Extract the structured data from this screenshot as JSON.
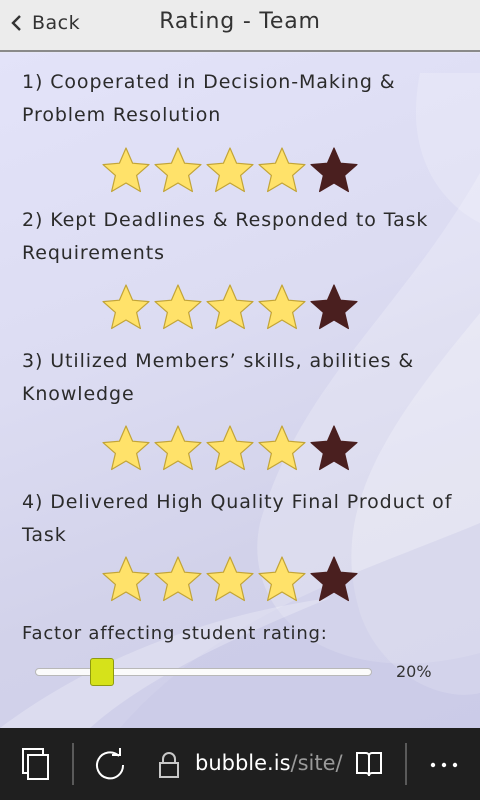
{
  "header": {
    "back_label": "Back",
    "title": "Rating - Team"
  },
  "questions": [
    {
      "text": "1) Cooperated in Decision-Making & Problem Resolution",
      "rating": 4,
      "max": 5
    },
    {
      "text": "2) Kept Deadlines & Responded to Task Requirements",
      "rating": 4,
      "max": 5
    },
    {
      "text": "3) Utilized Members’  skills, abilities & Knowledge",
      "rating": 4,
      "max": 5
    },
    {
      "text": "4) Delivered High Quality Final Product of Task",
      "rating": 4,
      "max": 5
    }
  ],
  "factor": {
    "label": "Factor affecting student rating:",
    "value": 20,
    "display": "20%"
  },
  "browser": {
    "url_domain": "bubble.is",
    "url_path": "/site/"
  },
  "colors": {
    "star_filled": "#ffe26a",
    "star_filled_stroke": "#c2a437",
    "star_empty": "#4a1f1f",
    "slider_thumb": "#d6e21a",
    "bottom_bar": "#1f1f1f"
  },
  "icons": [
    "chevron-left-icon",
    "tabs-icon",
    "refresh-icon",
    "lock-icon",
    "reading-view-icon",
    "more-icon"
  ]
}
